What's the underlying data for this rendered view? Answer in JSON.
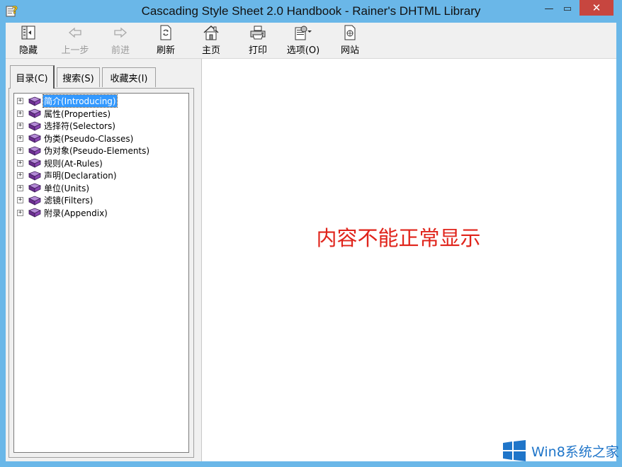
{
  "window": {
    "title": "Cascading Style Sheet 2.0 Handbook - Rainer's DHTML Library",
    "minimize_glyph": "—",
    "maximize_glyph": "▭",
    "close_glyph": "✕",
    "accent": "#6ab7e8"
  },
  "toolbar": {
    "hide": "隐藏",
    "back": "上一步",
    "forward": "前进",
    "refresh": "刷新",
    "home": "主页",
    "print": "打印",
    "options": "选项(O)",
    "web": "网站"
  },
  "tabs": [
    {
      "label": "目录(C)",
      "active": true
    },
    {
      "label": "搜索(S)",
      "active": false
    },
    {
      "label": "收藏夹(I)",
      "active": false
    }
  ],
  "tree": [
    {
      "label": "简介(Introducing)",
      "selected": true,
      "icon": "book-icon"
    },
    {
      "label": "属性(Properties)",
      "selected": false,
      "icon": "book-icon"
    },
    {
      "label": "选择符(Selectors)",
      "selected": false,
      "icon": "book-icon"
    },
    {
      "label": "伪类(Pseudo-Classes)",
      "selected": false,
      "icon": "book-icon"
    },
    {
      "label": "伪对象(Pseudo-Elements)",
      "selected": false,
      "icon": "book-icon"
    },
    {
      "label": "规则(At-Rules)",
      "selected": false,
      "icon": "book-icon"
    },
    {
      "label": "声明(Declaration)",
      "selected": false,
      "icon": "book-icon"
    },
    {
      "label": "单位(Units)",
      "selected": false,
      "icon": "book-icon"
    },
    {
      "label": "滤镜(Filters)",
      "selected": false,
      "icon": "book-icon"
    },
    {
      "label": "附录(Appendix)",
      "selected": false,
      "icon": "book-icon"
    }
  ],
  "content": {
    "message": "内容不能正常显示",
    "message_color": "#e0241b"
  },
  "watermark": {
    "text": "Win8系统之家",
    "color": "#1f75c9"
  }
}
